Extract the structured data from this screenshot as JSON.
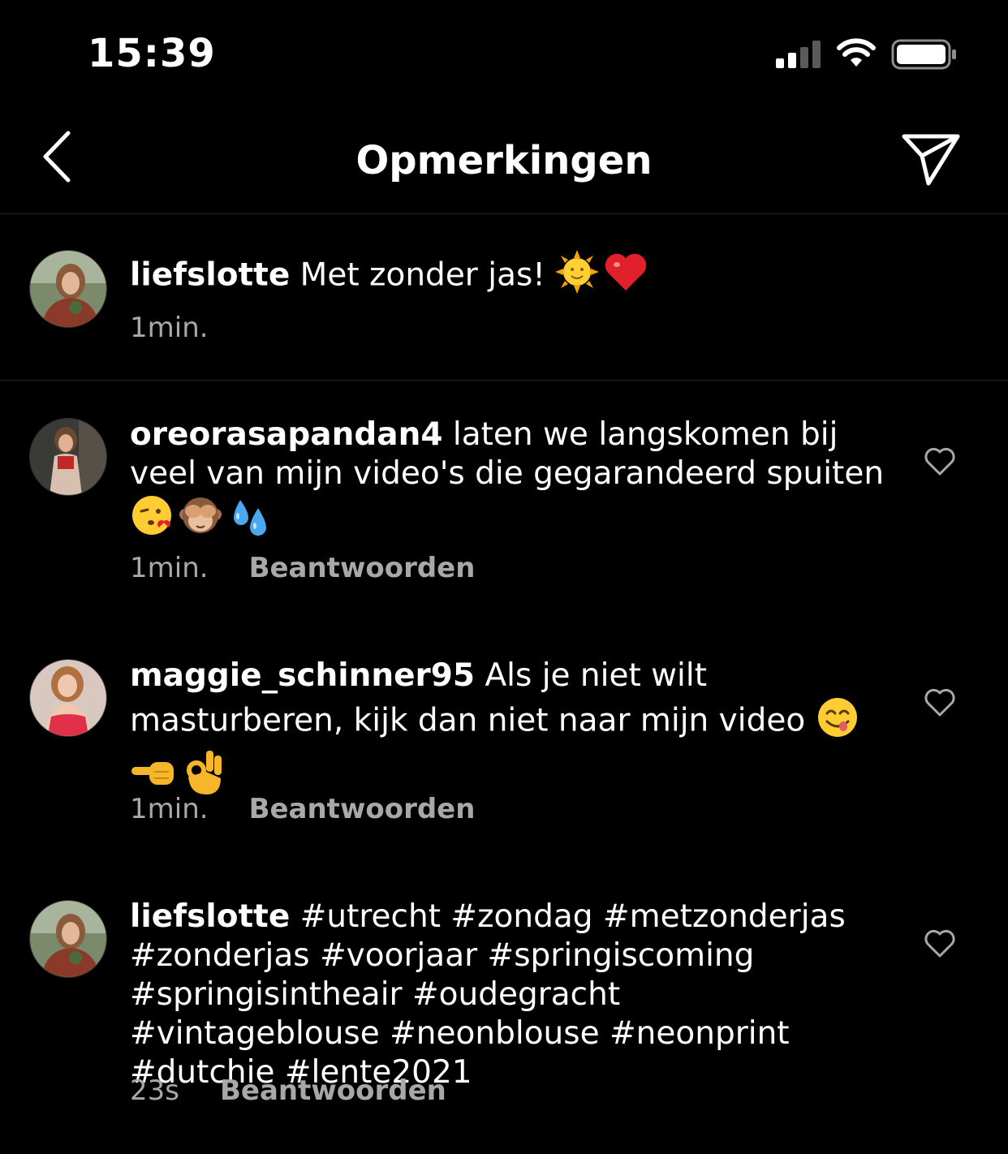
{
  "status_bar": {
    "time": "15:39",
    "icons": [
      "signal-icon",
      "wifi-icon",
      "battery-icon"
    ]
  },
  "nav": {
    "title": "Opmerkingen",
    "back_icon": "chevron-left-icon",
    "share_icon": "paper-plane-icon"
  },
  "caption": {
    "username": "liefslotte",
    "text": " Met zonder jas! ",
    "emojis": [
      "sun-with-face",
      "red-heart"
    ],
    "time": "1min."
  },
  "comments": [
    {
      "username": "oreorasapandan4",
      "text": " laten we langskomen bij veel van mijn video's die gegarandeerd spuiten",
      "emojis": [
        "face-blowing-kiss",
        "see-no-evil-monkey",
        "sweat-droplets"
      ],
      "time": "1min.",
      "reply_label": "Beantwoorden"
    },
    {
      "username": "maggie_schinner95",
      "text": " Als je niet wilt masturberen, kijk dan niet naar mijn video ",
      "emojis": [
        "face-savoring-food",
        "backhand-index-pointing-left",
        "ok-hand"
      ],
      "time": "1min.",
      "reply_label": "Beantwoorden"
    },
    {
      "username": "liefslotte",
      "text": " #utrecht #zondag #metzonderjas #zonderjas #voorjaar #springiscoming #springisintheair #oudegracht #vintageblouse #neonblouse #neonprint #dutchie #lente2021",
      "emojis": [],
      "time": "23s",
      "reply_label": "Beantwoorden"
    }
  ],
  "colors": {
    "background": "#000000",
    "text": "#ffffff",
    "secondary": "#a8a8a8",
    "divider": "#262626"
  }
}
